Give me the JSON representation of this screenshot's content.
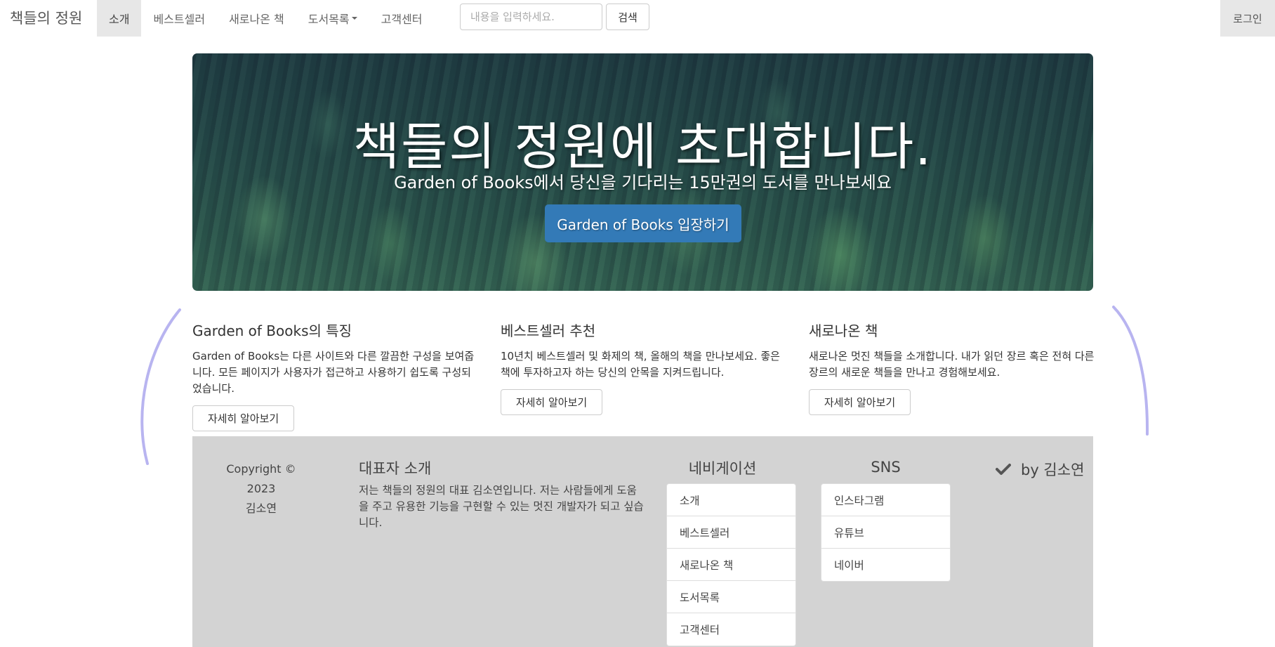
{
  "navbar": {
    "brand": "책들의 정원",
    "items": [
      {
        "label": "소개",
        "active": true
      },
      {
        "label": "베스트셀러"
      },
      {
        "label": "새로나온 책"
      },
      {
        "label": "도서목록",
        "dropdown": true
      },
      {
        "label": "고객센터"
      }
    ],
    "search_placeholder": "내용을 입력하세요.",
    "search_button": "검색",
    "login": "로그인"
  },
  "hero": {
    "title": "책들의 정원에 초대합니다.",
    "subtitle": "Garden of Books에서 당신을 기다리는 15만권의 도서를 만나보세요",
    "button": "Garden of Books 입장하기"
  },
  "features": [
    {
      "title": "Garden of Books의 특징",
      "text": "Garden of Books는 다른 사이트와 다른 깔끔한 구성을 보여줍니다. 모든 페이지가 사용자가 접근하고 사용하기 쉽도록 구성되었습니다.",
      "button": "자세히 알아보기"
    },
    {
      "title": "베스트셀러 추천",
      "text": "10년치 베스트셀러 및 화제의 책, 올해의 책을 만나보세요. 좋은 책에 투자하고자 하는 당신의 안목을 지켜드립니다.",
      "button": "자세히 알아보기"
    },
    {
      "title": "새로나온 책",
      "text": "새로나온 멋진 책들을 소개합니다. 내가 읽던 장르 혹은 전혀 다른 장르의 새로운 책들을 만나고 경험해보세요.",
      "button": "자세히 알아보기"
    }
  ],
  "footer": {
    "copyright_line1": "Copyright © 2023",
    "copyright_line2": "김소연",
    "ceo_title": "대표자 소개",
    "ceo_text": "저는 책들의 정원의 대표 김소연입니다. 저는 사람들에게 도움을 주고 유용한 기능을 구현할 수 있는 멋진 개발자가 되고 싶습니다.",
    "nav_title": "네비게이션",
    "nav_items": [
      "소개",
      "베스트셀러",
      "새로나온 책",
      "도서목록",
      "고객센터"
    ],
    "sns_title": "SNS",
    "sns_items": [
      "인스타그램",
      "유튜브",
      "네이버"
    ],
    "byline": "by 김소연"
  },
  "colors": {
    "primary": "#337ab7",
    "footer_bg": "#d3d3d3",
    "accent_arc": "#b8b4f0"
  }
}
